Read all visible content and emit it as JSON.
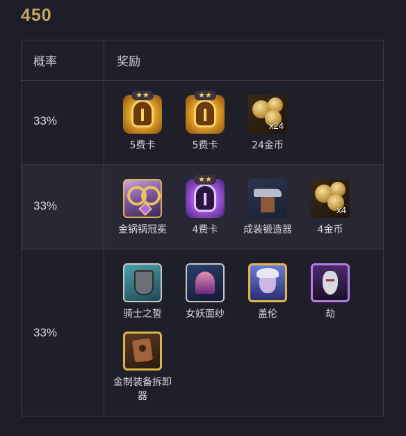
{
  "title": "450",
  "table": {
    "headers": {
      "probability": "概率",
      "rewards": "奖励"
    },
    "rows": [
      {
        "probability": "33%",
        "items": [
          {
            "label": "5费卡",
            "icon": "gold-helmet-card-icon",
            "stars": "★★"
          },
          {
            "label": "5费卡",
            "icon": "gold-helmet-card-icon",
            "stars": "★★"
          },
          {
            "label": "24金币",
            "icon": "gold-coins-icon",
            "quantity": "x24"
          }
        ]
      },
      {
        "probability": "33%",
        "items": [
          {
            "label": "金锅锅冠冕",
            "icon": "golden-crown-icon"
          },
          {
            "label": "4费卡",
            "icon": "purple-helmet-card-icon",
            "stars": "★★"
          },
          {
            "label": "成装锻造器",
            "icon": "anvil-forge-icon"
          },
          {
            "label": "4金币",
            "icon": "gold-coins-icon",
            "quantity": "x4"
          }
        ]
      },
      {
        "probability": "33%",
        "items": [
          {
            "label": "骑士之誓",
            "icon": "knight-shield-icon"
          },
          {
            "label": "女妖面纱",
            "icon": "banshee-veil-icon"
          },
          {
            "label": "盖伦",
            "icon": "champion-portrait-icon"
          },
          {
            "label": "劫",
            "icon": "champion-portrait-icon"
          },
          {
            "label": "金制装备拆卸器",
            "icon": "item-remover-icon"
          }
        ]
      }
    ]
  },
  "colors": {
    "background": "#1c1d27",
    "title": "#c3a664",
    "border": "#3a3b46",
    "row_alt": "#272833",
    "text": "#d8d9de",
    "star": "#f5d36b"
  }
}
